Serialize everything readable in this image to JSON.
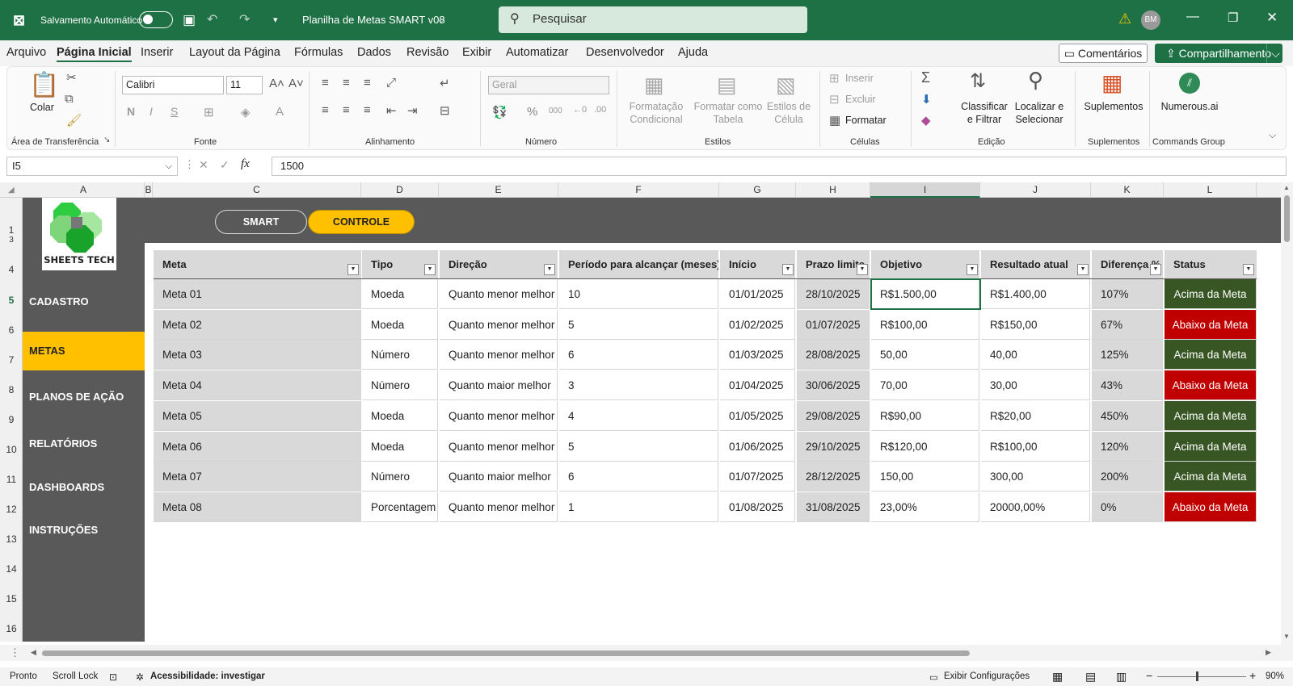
{
  "window": {
    "autosave_label": "Salvamento Automático",
    "doc_title": "Planilha de Metas SMART v08",
    "search_placeholder": "Pesquisar",
    "user_initials": "BM"
  },
  "menu": [
    "Arquivo",
    "Página Inicial",
    "Inserir",
    "Layout da Página",
    "Fórmulas",
    "Dados",
    "Revisão",
    "Exibir",
    "Automatizar",
    "Desenvolvedor",
    "Ajuda"
  ],
  "menu_active": "Página Inicial",
  "comments_label": "Comentários",
  "share_label": "Compartilhamento",
  "ribbon": {
    "paste": "Colar",
    "font_name": "Calibri",
    "font_size": "11",
    "bold": "N",
    "italic": "I",
    "underline": "S",
    "number_format": "Geral",
    "cond_format_1": "Formatação",
    "cond_format_2": "Condicional",
    "format_table_1": "Formatar como",
    "format_table_2": "Tabela",
    "cell_styles_1": "Estilos de",
    "cell_styles_2": "Célula",
    "insert": "Inserir",
    "delete": "Excluir",
    "format": "Formatar",
    "sort_1": "Classificar",
    "sort_2": "e Filtrar",
    "find_1": "Localizar e",
    "find_2": "Selecionar",
    "addins": "Suplementos",
    "numerous": "Numerous.ai",
    "groups": {
      "clipboard": "Área de Transferência",
      "font": "Fonte",
      "alignment": "Alinhamento",
      "number": "Número",
      "styles": "Estilos",
      "cells": "Células",
      "editing": "Edição",
      "addins": "Suplementos",
      "commands": "Commands Group"
    }
  },
  "formula_bar": {
    "name_box": "I5",
    "fx": "fx",
    "value": "1500"
  },
  "columns": [
    "A",
    "B",
    "C",
    "D",
    "E",
    "F",
    "G",
    "H",
    "I",
    "J",
    "K",
    "L"
  ],
  "rows": [
    "1",
    "3",
    "4",
    "5",
    "6",
    "7",
    "8",
    "9",
    "10",
    "11",
    "12",
    "13",
    "14",
    "15",
    "16"
  ],
  "logo_text": "SHEETS TECH",
  "tabs": {
    "smart": "SMART",
    "controle": "CONTROLE"
  },
  "nav": [
    "CADASTRO",
    "METAS",
    "PLANOS DE AÇÃO",
    "RELATÓRIOS",
    "DASHBOARDS",
    "INSTRUÇÕES"
  ],
  "nav_active": "METAS",
  "table": {
    "headers": [
      "Meta",
      "Tipo",
      "Direção",
      "Período para alcançar (meses)",
      "Início",
      "Prazo limite",
      "Objetivo",
      "Resultado atual",
      "Diferença %",
      "Status"
    ],
    "rows": [
      [
        "Meta 01",
        "Moeda",
        "Quanto menor melhor",
        "10",
        "01/01/2025",
        "28/10/2025",
        "R$1.500,00",
        "R$1.400,00",
        "107%",
        "Acima da Meta"
      ],
      [
        "Meta 02",
        "Moeda",
        "Quanto menor melhor",
        "5",
        "01/02/2025",
        "01/07/2025",
        "R$100,00",
        "R$150,00",
        "67%",
        "Abaixo da Meta"
      ],
      [
        "Meta 03",
        "Número",
        "Quanto menor melhor",
        "6",
        "01/03/2025",
        "28/08/2025",
        "50,00",
        "40,00",
        "125%",
        "Acima da Meta"
      ],
      [
        "Meta 04",
        "Número",
        "Quanto maior melhor",
        "3",
        "01/04/2025",
        "30/06/2025",
        "70,00",
        "30,00",
        "43%",
        "Abaixo da Meta"
      ],
      [
        "Meta 05",
        "Moeda",
        "Quanto menor melhor",
        "4",
        "01/05/2025",
        "29/08/2025",
        "R$90,00",
        "R$20,00",
        "450%",
        "Acima da Meta"
      ],
      [
        "Meta 06",
        "Moeda",
        "Quanto menor melhor",
        "5",
        "01/06/2025",
        "29/10/2025",
        "R$120,00",
        "R$100,00",
        "120%",
        "Acima da Meta"
      ],
      [
        "Meta 07",
        "Número",
        "Quanto maior melhor",
        "6",
        "01/07/2025",
        "28/12/2025",
        "150,00",
        "300,00",
        "200%",
        "Acima da Meta"
      ],
      [
        "Meta 08",
        "Porcentagem",
        "Quanto menor melhor",
        "1",
        "01/08/2025",
        "31/08/2025",
        "23,00%",
        "20000,00%",
        "0%",
        "Abaixo da Meta"
      ]
    ]
  },
  "colors": {
    "excel_green": "#1e7145",
    "above": "#375623",
    "below": "#c00000",
    "accent_yellow": "#ffc000",
    "panel_gray": "#595959"
  },
  "status_bar": {
    "ready": "Pronto",
    "scroll_lock": "Scroll Lock",
    "accessibility": "Acessibilidade: investigar",
    "display_settings": "Exibir Configurações",
    "zoom": "90%"
  }
}
